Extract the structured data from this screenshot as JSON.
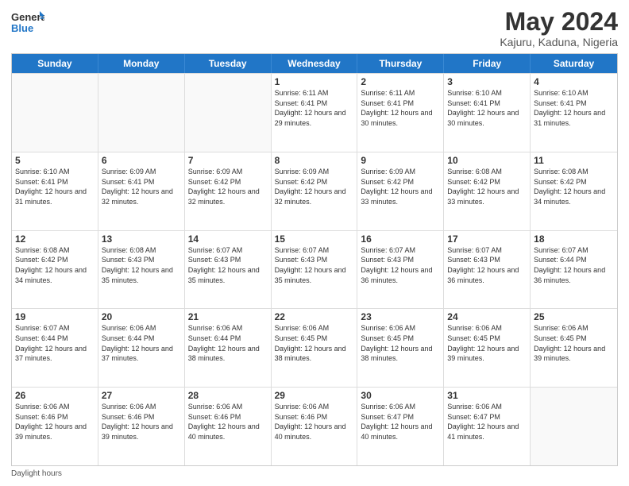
{
  "logo": {
    "line1": "General",
    "line2": "Blue"
  },
  "title": "May 2024",
  "subtitle": "Kajuru, Kaduna, Nigeria",
  "days": [
    "Sunday",
    "Monday",
    "Tuesday",
    "Wednesday",
    "Thursday",
    "Friday",
    "Saturday"
  ],
  "weeks": [
    [
      {
        "day": "",
        "info": ""
      },
      {
        "day": "",
        "info": ""
      },
      {
        "day": "",
        "info": ""
      },
      {
        "day": "1",
        "info": "Sunrise: 6:11 AM\nSunset: 6:41 PM\nDaylight: 12 hours and 29 minutes."
      },
      {
        "day": "2",
        "info": "Sunrise: 6:11 AM\nSunset: 6:41 PM\nDaylight: 12 hours and 30 minutes."
      },
      {
        "day": "3",
        "info": "Sunrise: 6:10 AM\nSunset: 6:41 PM\nDaylight: 12 hours and 30 minutes."
      },
      {
        "day": "4",
        "info": "Sunrise: 6:10 AM\nSunset: 6:41 PM\nDaylight: 12 hours and 31 minutes."
      }
    ],
    [
      {
        "day": "5",
        "info": "Sunrise: 6:10 AM\nSunset: 6:41 PM\nDaylight: 12 hours and 31 minutes."
      },
      {
        "day": "6",
        "info": "Sunrise: 6:09 AM\nSunset: 6:41 PM\nDaylight: 12 hours and 32 minutes."
      },
      {
        "day": "7",
        "info": "Sunrise: 6:09 AM\nSunset: 6:42 PM\nDaylight: 12 hours and 32 minutes."
      },
      {
        "day": "8",
        "info": "Sunrise: 6:09 AM\nSunset: 6:42 PM\nDaylight: 12 hours and 32 minutes."
      },
      {
        "day": "9",
        "info": "Sunrise: 6:09 AM\nSunset: 6:42 PM\nDaylight: 12 hours and 33 minutes."
      },
      {
        "day": "10",
        "info": "Sunrise: 6:08 AM\nSunset: 6:42 PM\nDaylight: 12 hours and 33 minutes."
      },
      {
        "day": "11",
        "info": "Sunrise: 6:08 AM\nSunset: 6:42 PM\nDaylight: 12 hours and 34 minutes."
      }
    ],
    [
      {
        "day": "12",
        "info": "Sunrise: 6:08 AM\nSunset: 6:42 PM\nDaylight: 12 hours and 34 minutes."
      },
      {
        "day": "13",
        "info": "Sunrise: 6:08 AM\nSunset: 6:43 PM\nDaylight: 12 hours and 35 minutes."
      },
      {
        "day": "14",
        "info": "Sunrise: 6:07 AM\nSunset: 6:43 PM\nDaylight: 12 hours and 35 minutes."
      },
      {
        "day": "15",
        "info": "Sunrise: 6:07 AM\nSunset: 6:43 PM\nDaylight: 12 hours and 35 minutes."
      },
      {
        "day": "16",
        "info": "Sunrise: 6:07 AM\nSunset: 6:43 PM\nDaylight: 12 hours and 36 minutes."
      },
      {
        "day": "17",
        "info": "Sunrise: 6:07 AM\nSunset: 6:43 PM\nDaylight: 12 hours and 36 minutes."
      },
      {
        "day": "18",
        "info": "Sunrise: 6:07 AM\nSunset: 6:44 PM\nDaylight: 12 hours and 36 minutes."
      }
    ],
    [
      {
        "day": "19",
        "info": "Sunrise: 6:07 AM\nSunset: 6:44 PM\nDaylight: 12 hours and 37 minutes."
      },
      {
        "day": "20",
        "info": "Sunrise: 6:06 AM\nSunset: 6:44 PM\nDaylight: 12 hours and 37 minutes."
      },
      {
        "day": "21",
        "info": "Sunrise: 6:06 AM\nSunset: 6:44 PM\nDaylight: 12 hours and 38 minutes."
      },
      {
        "day": "22",
        "info": "Sunrise: 6:06 AM\nSunset: 6:45 PM\nDaylight: 12 hours and 38 minutes."
      },
      {
        "day": "23",
        "info": "Sunrise: 6:06 AM\nSunset: 6:45 PM\nDaylight: 12 hours and 38 minutes."
      },
      {
        "day": "24",
        "info": "Sunrise: 6:06 AM\nSunset: 6:45 PM\nDaylight: 12 hours and 39 minutes."
      },
      {
        "day": "25",
        "info": "Sunrise: 6:06 AM\nSunset: 6:45 PM\nDaylight: 12 hours and 39 minutes."
      }
    ],
    [
      {
        "day": "26",
        "info": "Sunrise: 6:06 AM\nSunset: 6:46 PM\nDaylight: 12 hours and 39 minutes."
      },
      {
        "day": "27",
        "info": "Sunrise: 6:06 AM\nSunset: 6:46 PM\nDaylight: 12 hours and 39 minutes."
      },
      {
        "day": "28",
        "info": "Sunrise: 6:06 AM\nSunset: 6:46 PM\nDaylight: 12 hours and 40 minutes."
      },
      {
        "day": "29",
        "info": "Sunrise: 6:06 AM\nSunset: 6:46 PM\nDaylight: 12 hours and 40 minutes."
      },
      {
        "day": "30",
        "info": "Sunrise: 6:06 AM\nSunset: 6:47 PM\nDaylight: 12 hours and 40 minutes."
      },
      {
        "day": "31",
        "info": "Sunrise: 6:06 AM\nSunset: 6:47 PM\nDaylight: 12 hours and 41 minutes."
      },
      {
        "day": "",
        "info": ""
      }
    ]
  ],
  "footer": "Daylight hours"
}
